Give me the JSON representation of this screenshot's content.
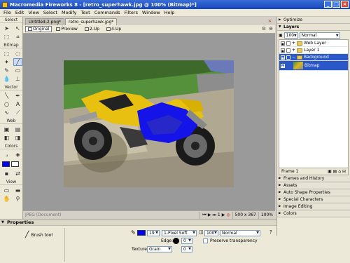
{
  "window": {
    "title": "Macromedia Fireworks 8 - [retro_superhawk.jpg @ 100% (Bitmap)*]"
  },
  "menu": [
    "File",
    "Edit",
    "View",
    "Select",
    "Modify",
    "Text",
    "Commands",
    "Filters",
    "Window",
    "Help"
  ],
  "tools": {
    "sections": [
      "Select",
      "Bitmap",
      "Vector",
      "Web",
      "Colors",
      "View"
    ]
  },
  "doc": {
    "tabs": [
      "Untitled-2.png*",
      "retro_superhawk.jpg*"
    ],
    "views": [
      "Original",
      "Preview",
      "2-Up",
      "4-Up"
    ]
  },
  "status": {
    "doc_label": "JPEG (Document)",
    "page": "1",
    "size": "500 x 367",
    "zoom": "100%"
  },
  "panels": {
    "optimize": "Optimize",
    "layers": "Layers",
    "opacity": "100",
    "blend": "Normal",
    "layer_rows": [
      "Web Layer",
      "Layer 1",
      "Background",
      "Bitmap"
    ],
    "frame": "Frame 1",
    "collapsed": [
      "Frames and History",
      "Assets",
      "Auto Shape Properties",
      "Special Characters",
      "Image Editing",
      "Colors"
    ]
  },
  "properties": {
    "title": "Properties",
    "tool_name": "Brush tool",
    "size": "19",
    "stroke": "1-Pixel Soft",
    "edge_label": "Edge:",
    "edge": "0",
    "texture_label": "Texture:",
    "texture": "Grain",
    "texture_amount": "0",
    "opacity": "100",
    "blend": "Normal",
    "preserve": "Preserve transparency"
  },
  "colors": {
    "accent": "#2a58c8",
    "stroke_color": "#0000ff"
  }
}
